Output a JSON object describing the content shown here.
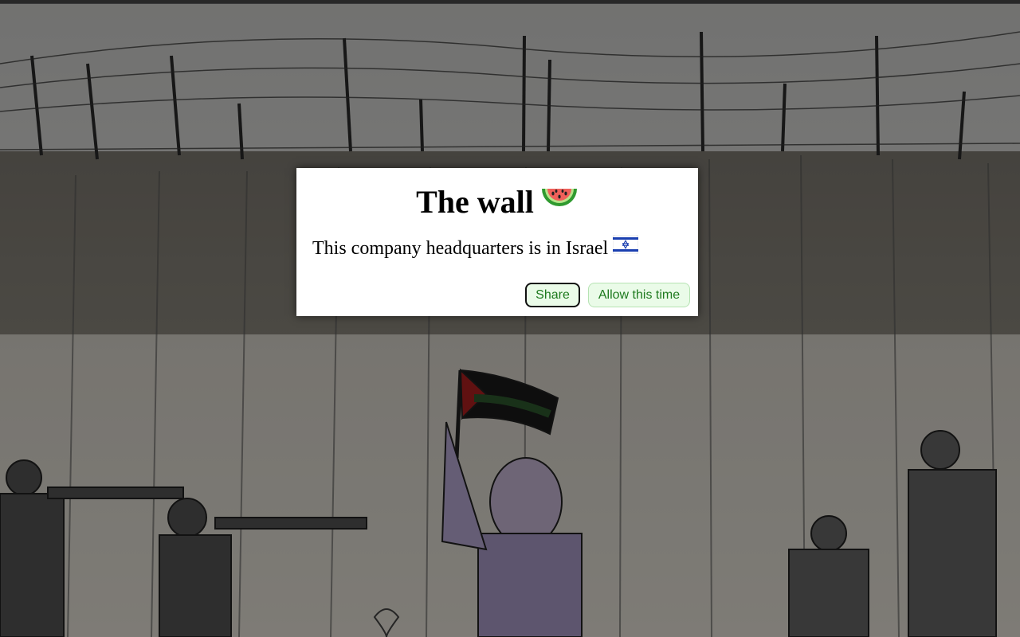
{
  "dialog": {
    "title": "The wall",
    "title_icon": "watermelon-icon",
    "message": "This company headquarters is in Israel",
    "message_icon": "israel-flag-icon"
  },
  "buttons": {
    "share_label": "Share",
    "allow_label": "Allow this time"
  },
  "colors": {
    "button_bg": "#eafbe8",
    "button_text": "#1e7a1e",
    "overlay": "rgba(0,0,0,0.45)"
  }
}
